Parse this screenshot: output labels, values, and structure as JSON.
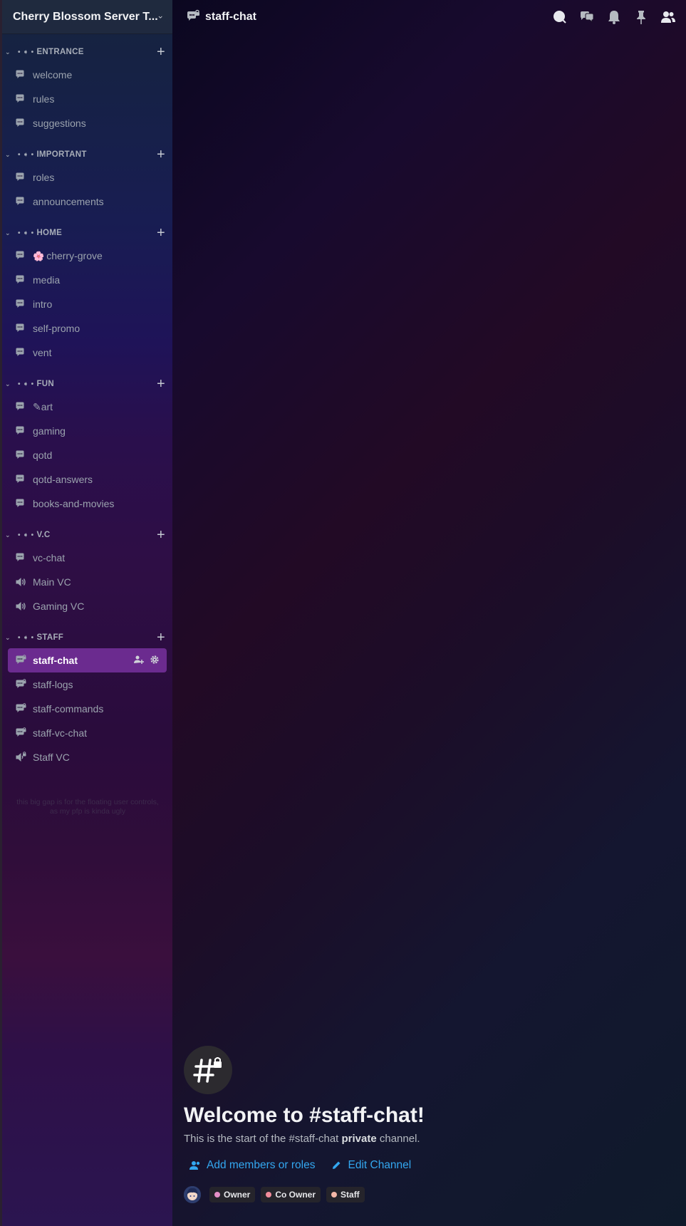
{
  "server": {
    "name": "Cherry Blossom Server T..."
  },
  "sidebar": {
    "categories": [
      {
        "label": "ENTRANCE",
        "prefix": "• ➧ •",
        "channels": [
          {
            "name": "welcome",
            "type": "forum"
          },
          {
            "name": "rules",
            "type": "forum"
          },
          {
            "name": "suggestions",
            "type": "forum"
          }
        ]
      },
      {
        "label": "IMPORTANT",
        "prefix": "• ➧ •",
        "channels": [
          {
            "name": "roles",
            "type": "forum"
          },
          {
            "name": "announcements",
            "type": "forum"
          }
        ]
      },
      {
        "label": "HOME",
        "prefix": "• ➧ •",
        "channels": [
          {
            "name": "cherry-grove",
            "type": "forum",
            "emoji": "🌸"
          },
          {
            "name": "media",
            "type": "forum"
          },
          {
            "name": "intro",
            "type": "forum"
          },
          {
            "name": "self-promo",
            "type": "forum"
          },
          {
            "name": "vent",
            "type": "forum"
          }
        ]
      },
      {
        "label": "FUN",
        "prefix": "• ➧ •",
        "channels": [
          {
            "name": "✎art",
            "type": "forum"
          },
          {
            "name": "gaming",
            "type": "forum"
          },
          {
            "name": "qotd",
            "type": "forum"
          },
          {
            "name": "qotd-answers",
            "type": "forum"
          },
          {
            "name": "books-and-movies",
            "type": "forum"
          }
        ]
      },
      {
        "label": "V.C",
        "prefix": "• ➧ •",
        "channels": [
          {
            "name": "vc-chat",
            "type": "forum"
          },
          {
            "name": "Main VC",
            "type": "voice"
          },
          {
            "name": "Gaming VC",
            "type": "voice"
          }
        ]
      },
      {
        "label": "STAFF",
        "prefix": "• ➧ •",
        "channels": [
          {
            "name": "staff-chat",
            "type": "forum-locked",
            "active": true
          },
          {
            "name": "staff-logs",
            "type": "forum-locked"
          },
          {
            "name": "staff-commands",
            "type": "forum-locked"
          },
          {
            "name": "staff-vc-chat",
            "type": "forum-locked"
          },
          {
            "name": "Staff VC",
            "type": "voice-locked"
          }
        ]
      }
    ],
    "faint_note": "this big gap is for the floating user controls, as my pfp is kinda ugly"
  },
  "topbar": {
    "channel": "staff-chat",
    "icons": [
      "threads-icon",
      "chat-bubbles-icon",
      "bell-icon",
      "pin-icon",
      "members-icon"
    ]
  },
  "welcome": {
    "title": "Welcome to #staff-chat!",
    "desc_pre": "This is the start of the #staff-chat ",
    "desc_bold": "private",
    "desc_post": " channel.",
    "add_members": "Add members or roles",
    "edit_channel": "Edit Channel",
    "roles": [
      {
        "name": "Owner",
        "color": "#e58fc7"
      },
      {
        "name": "Co Owner",
        "color": "#f28c9b"
      },
      {
        "name": "Staff",
        "color": "#f5b8a8"
      }
    ]
  }
}
